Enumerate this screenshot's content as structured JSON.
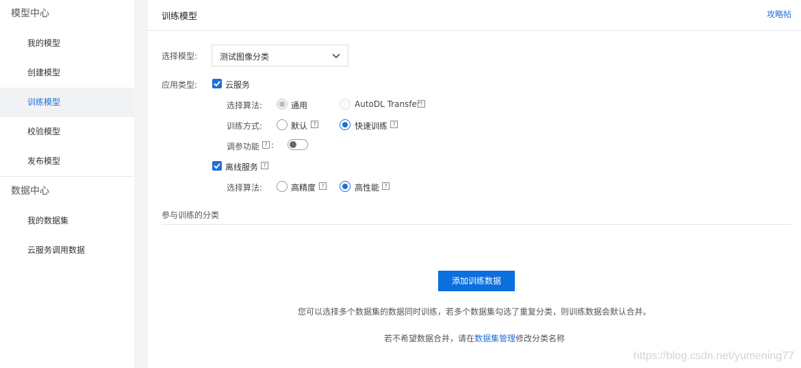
{
  "sidebar": {
    "groups": [
      {
        "title": "模型中心",
        "items": [
          "我的模型",
          "创建模型",
          "训练模型",
          "校验模型",
          "发布模型"
        ]
      },
      {
        "title": "数据中心",
        "items": [
          "我的数据集",
          "云服务调用数据"
        ]
      }
    ],
    "active": "训练模型"
  },
  "header": {
    "title": "训练模型",
    "guide_link": "攻略帖"
  },
  "form": {
    "model_label": "选择模型:",
    "model_value": "测试图像分类",
    "app_type_label": "应用类型:",
    "cloud": {
      "label": "云服务",
      "checked": true,
      "algo_label": "选择算法:",
      "algo_options": [
        "通用",
        "AutoDL Transfer"
      ],
      "train_label": "训练方式:",
      "train_options": [
        "默认",
        "快速训练"
      ],
      "tune_label": "调参功能"
    },
    "offline": {
      "label": "离线服务",
      "checked": true,
      "algo_label": "选择算法:",
      "algo_options": [
        "高精度",
        "高性能"
      ]
    }
  },
  "categories": {
    "section_label": "参与训练的分类",
    "add_button": "添加训练数据",
    "info_line": "您可以选择多个数据集的数据同时训练，若多个数据集勾选了重复分类，则训练数据会默认合并。",
    "merge_prefix": "若不希望数据合并，请在",
    "merge_link": "数据集管理",
    "merge_suffix": "修改分类名称"
  },
  "watermark": "https://blog.csdn.net/yumening77",
  "colors": {
    "accent": "#1f6fd6",
    "button": "#0b6fde"
  },
  "help_glyph": "?"
}
